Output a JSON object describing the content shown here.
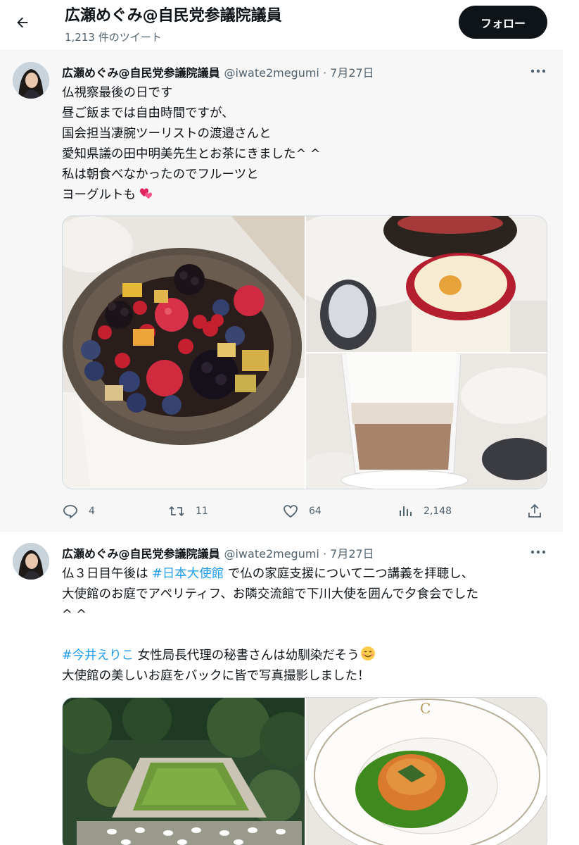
{
  "header": {
    "title": "広瀬めぐみ@自民党参議院議員",
    "tweet_count": "1,213 件のツイート",
    "follow_label": "フォロー"
  },
  "tweets": [
    {
      "author_name": "広瀬めぐみ@自民党参議院議員",
      "handle_date": "@iwate2megumi · 7月27日",
      "lines": [
        "仏視察最後の日です",
        "昼ご飯までは自由時間ですが、",
        "国会担当凄腕ツーリストの渡邉さんと",
        "愛知県議の田中明美先生とお茶にきました^ ^",
        "私は朝食べなかったのでフルーツと",
        "ヨーグルトも"
      ],
      "media": [
        "fruit bowl",
        "yogurt cup",
        "café latte"
      ],
      "replies": "4",
      "retweets": "11",
      "likes": "64",
      "views": "2,148"
    },
    {
      "author_name": "広瀬めぐみ@自民党参議院議員",
      "handle_date": "@iwate2megumi · 7月27日",
      "line1_pre": "仏３日目午後は ",
      "hashtag1": "#日本大使館",
      "line1_post": " で仏の家庭支援について二つ講義を拝聴し、",
      "line2": "大使館のお庭でアペリティフ、お隣交流館で下川大使を囲んで夕食会でした",
      "line3": "^ ^",
      "hashtag2": "#今井えりこ",
      "line4_post": " 女性局長代理の秘書さんは幼馴染だそう",
      "line5": "大使館の美しいお庭をバックに皆で写真撮影しました！",
      "media": [
        "embassy garden",
        "green soup plate"
      ]
    }
  ],
  "colors": {
    "accent": "#1d9bf0",
    "text": "#0f1419",
    "muted": "#536471",
    "heart_emoji": "#e0245e"
  }
}
